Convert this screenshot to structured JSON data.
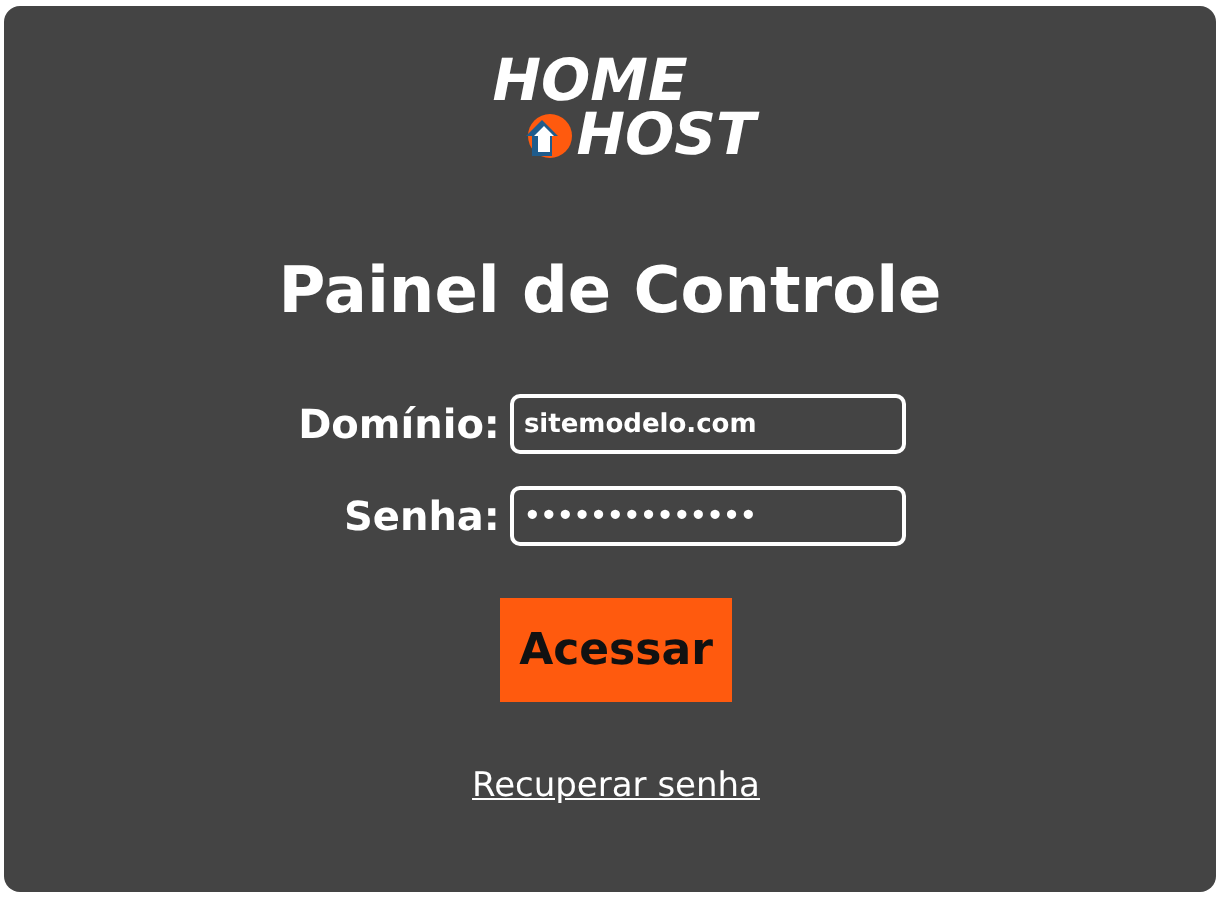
{
  "logo": {
    "line_1": "HOME",
    "line_2": "HOST"
  },
  "title": "Painel de Controle",
  "fields": [
    {
      "label": "Domínio:",
      "value": "sitemodelo.com"
    },
    {
      "label": "Senha:",
      "value": "••••••••••••••"
    }
  ],
  "submit_button": "Acessar",
  "link": "Recuperar senha"
}
